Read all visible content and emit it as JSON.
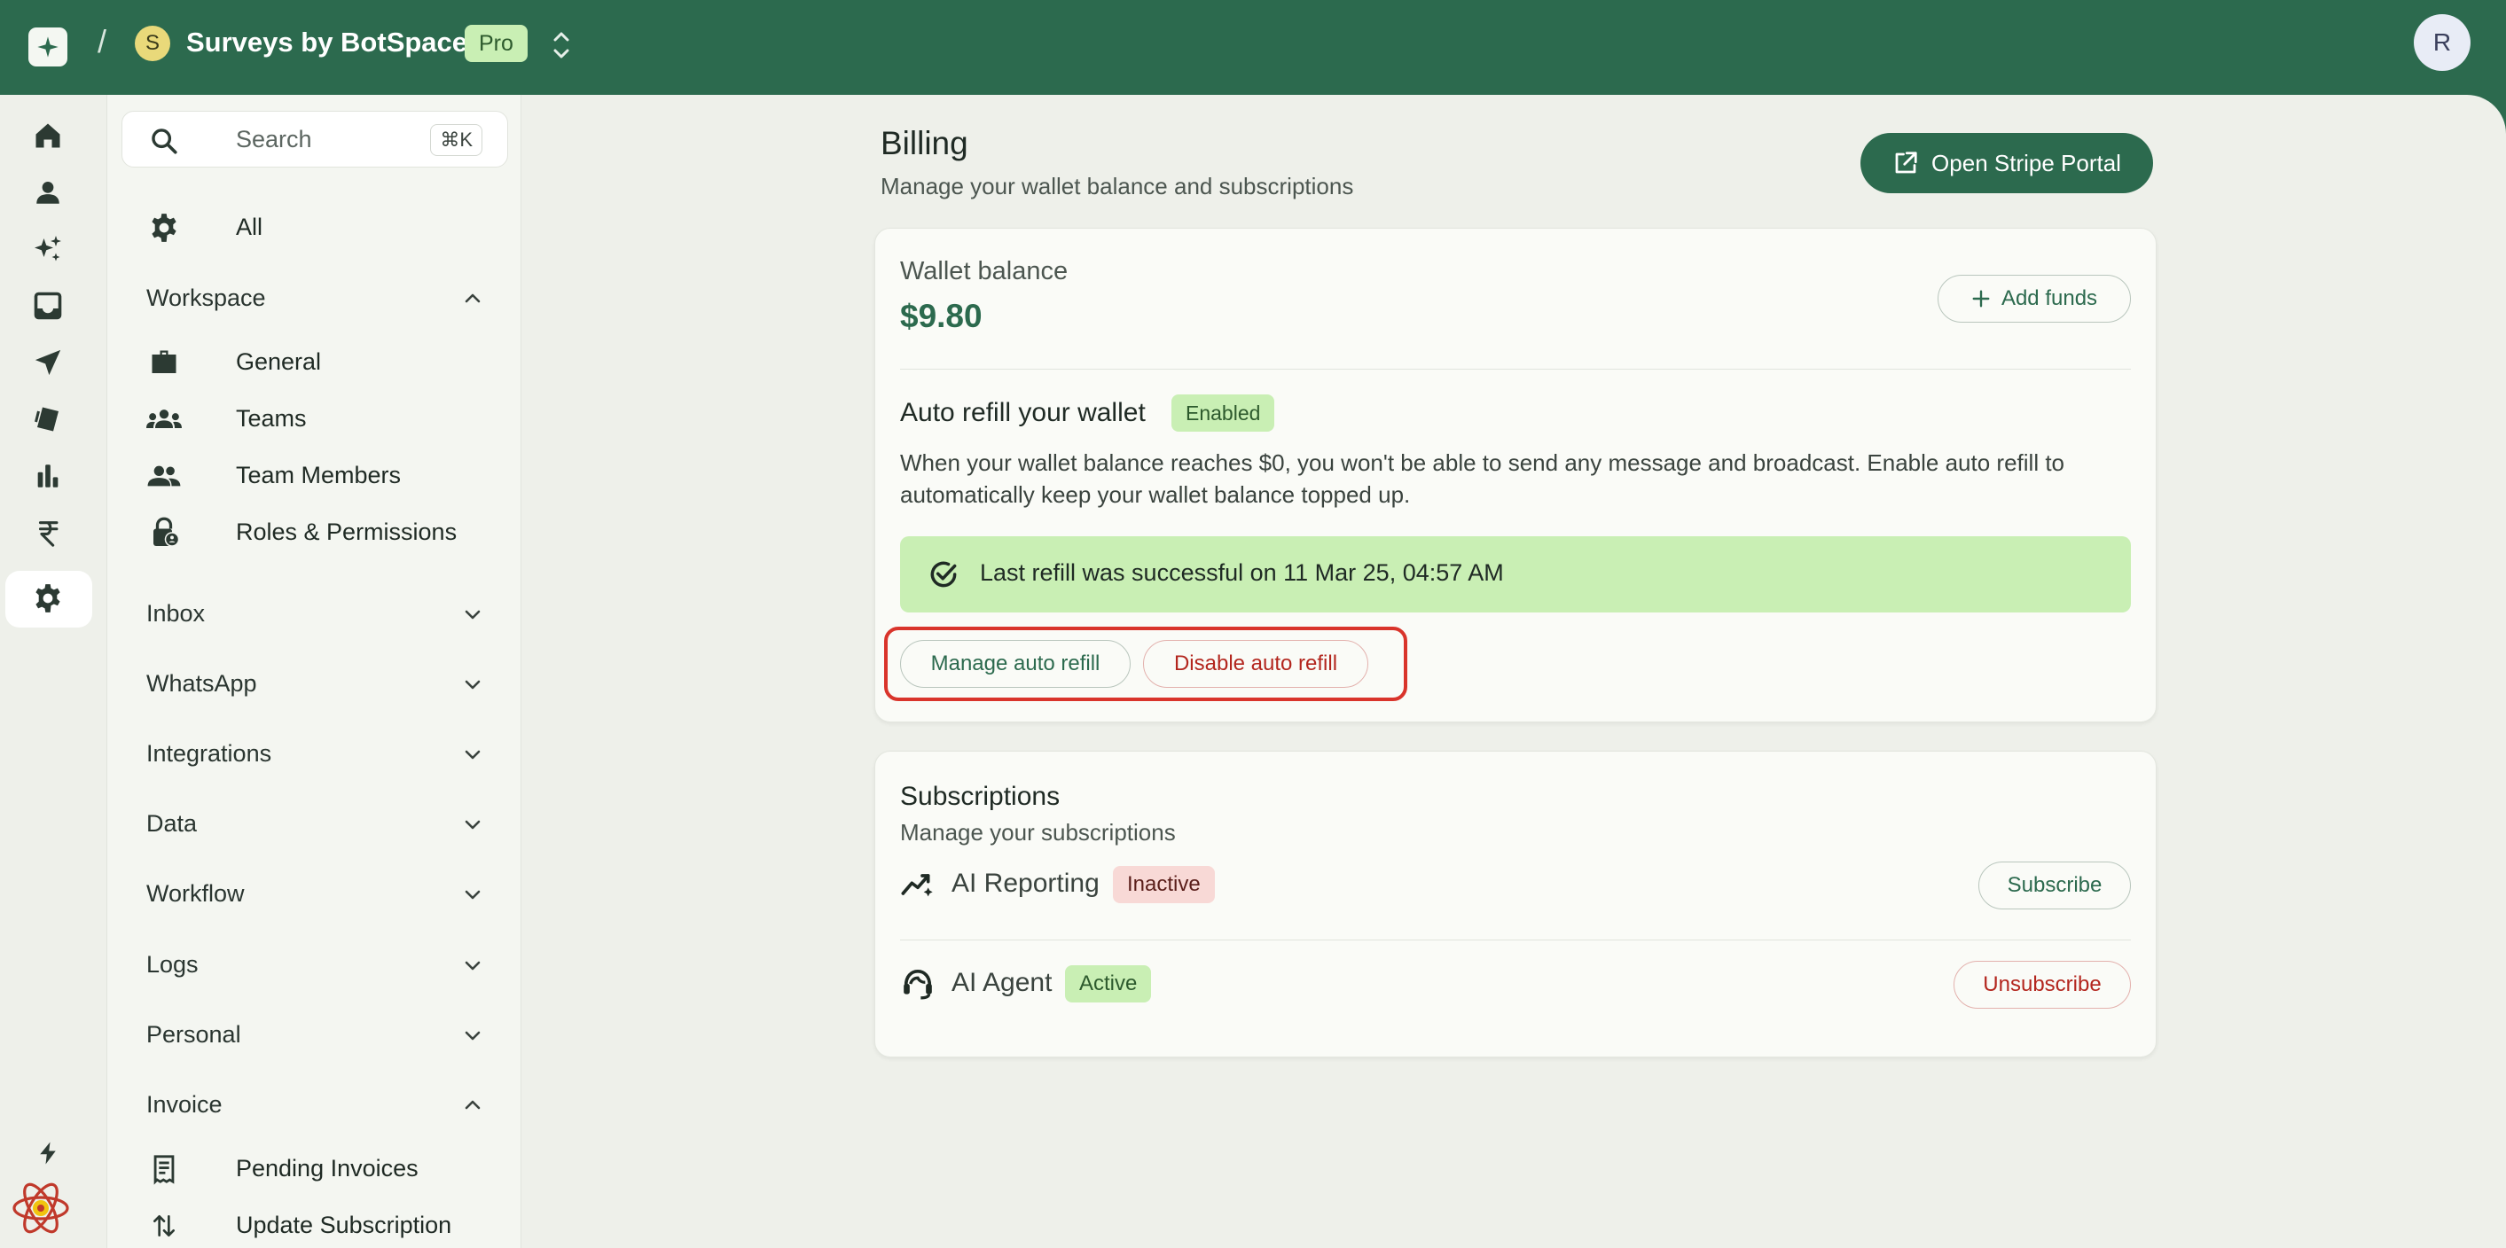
{
  "topbar": {
    "workspace_initial": "S",
    "workspace_name": "Surveys by BotSpace",
    "plan_badge": "Pro",
    "separator": "/",
    "user_initial": "R"
  },
  "rail": {
    "icons": [
      "home-icon",
      "person-icon",
      "sparkles-icon",
      "inbox-icon",
      "send-icon",
      "tags-icon",
      "bar-chart-icon",
      "rupee-icon",
      "gear-icon",
      "bolt-icon",
      "react-logo-icon"
    ],
    "active": "gear-icon"
  },
  "sidebar": {
    "search": {
      "label": "Search",
      "shortcut": "⌘K"
    },
    "all_label": "All",
    "workspace": {
      "label": "Workspace",
      "items": [
        {
          "label": "General",
          "icon": "briefcase-icon"
        },
        {
          "label": "Teams",
          "icon": "groups-icon"
        },
        {
          "label": "Team Members",
          "icon": "people-icon"
        },
        {
          "label": "Roles & Permissions",
          "icon": "lock-person-icon"
        }
      ]
    },
    "groups": [
      "Inbox",
      "WhatsApp",
      "Integrations",
      "Data",
      "Workflow",
      "Logs",
      "Personal"
    ],
    "invoice": {
      "label": "Invoice",
      "items": [
        {
          "label": "Pending Invoices",
          "icon": "receipt-icon"
        },
        {
          "label": "Update Subscription",
          "icon": "swap-vert-icon"
        }
      ]
    }
  },
  "billing": {
    "title": "Billing",
    "subtitle": "Manage your wallet balance and subscriptions",
    "stripe_button": "Open Stripe Portal"
  },
  "wallet": {
    "label": "Wallet balance",
    "value": "$9.80",
    "add_funds": "Add funds",
    "auto_refill_title": "Auto refill your wallet",
    "auto_refill_status": "Enabled",
    "auto_refill_desc": "When your wallet balance reaches $0, you won't be able to send any message and broadcast. Enable auto refill to automatically keep your wallet balance topped up.",
    "last_refill": "Last refill was successful on 11 Mar 25, 04:57 AM",
    "manage_button": "Manage auto refill",
    "disable_button": "Disable auto refill"
  },
  "subscriptions": {
    "title": "Subscriptions",
    "subtitle": "Manage your subscriptions",
    "items": [
      {
        "name": "AI Reporting",
        "status": "Inactive",
        "action": "Subscribe"
      },
      {
        "name": "AI Agent",
        "status": "Active",
        "action": "Unsubscribe"
      }
    ]
  },
  "colors": {
    "brand": "#2c6a4e",
    "success_bg": "#c9efb4",
    "danger": "#b3261e",
    "highlight": "#d9342b"
  }
}
